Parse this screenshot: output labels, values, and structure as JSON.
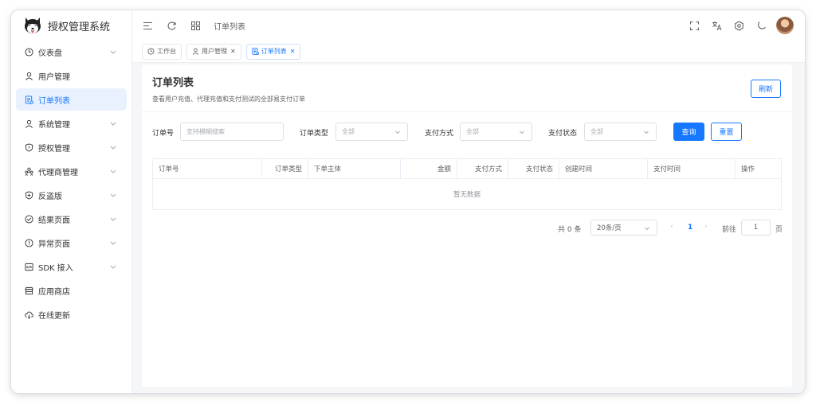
{
  "app": {
    "title": "授权管理系统"
  },
  "sidebar": {
    "items": [
      {
        "label": "仪表盘",
        "icon": "dashboard-icon",
        "expandable": true
      },
      {
        "label": "用户管理",
        "icon": "user-icon",
        "expandable": false
      },
      {
        "label": "订单列表",
        "icon": "order-list-icon",
        "expandable": false,
        "active": true
      },
      {
        "label": "系统管理",
        "icon": "user-settings-icon",
        "expandable": true
      },
      {
        "label": "授权管理",
        "icon": "shield-icon",
        "expandable": true
      },
      {
        "label": "代理商管理",
        "icon": "agents-icon",
        "expandable": true
      },
      {
        "label": "反盗版",
        "icon": "shield-plus-icon",
        "expandable": true
      },
      {
        "label": "结果页面",
        "icon": "check-circle-icon",
        "expandable": true
      },
      {
        "label": "异常页面",
        "icon": "warning-circle-icon",
        "expandable": true
      },
      {
        "label": "SDK 接入",
        "icon": "code-icon",
        "expandable": true
      },
      {
        "label": "应用商店",
        "icon": "store-icon",
        "expandable": false
      },
      {
        "label": "在线更新",
        "icon": "cloud-download-icon",
        "expandable": false
      }
    ]
  },
  "topbar": {
    "breadcrumb": "订单列表",
    "icons": [
      "menu-fold-icon",
      "refresh-icon",
      "grid-icon",
      "fullscreen-icon",
      "translate-icon",
      "settings-icon",
      "moon-icon"
    ]
  },
  "tabs": [
    {
      "label": "工作台",
      "icon": "dashboard-icon",
      "closable": false,
      "active": false
    },
    {
      "label": "用户管理",
      "icon": "user-icon",
      "closable": true,
      "active": false
    },
    {
      "label": "订单列表",
      "icon": "order-list-icon",
      "closable": true,
      "active": true
    }
  ],
  "page": {
    "title": "订单列表",
    "description": "查看用户充值、代理充值和支付测试的全部易支付订单",
    "refresh_label": "刷新"
  },
  "filters": {
    "order_no_label": "订单号",
    "order_no_placeholder": "支持模糊搜索",
    "order_type_label": "订单类型",
    "order_type_value": "全部",
    "pay_method_label": "支付方式",
    "pay_method_value": "全部",
    "pay_status_label": "支付状态",
    "pay_status_value": "全部",
    "search_label": "查询",
    "reset_label": "重置"
  },
  "table": {
    "columns": [
      "订单号",
      "订单类型",
      "下单主体",
      "金额",
      "支付方式",
      "支付状态",
      "创建时间",
      "支付时间",
      "操作"
    ],
    "empty_text": "暂无数据"
  },
  "pagination": {
    "total_text": "共 0 条",
    "page_size": "20条/页",
    "current_page": "1",
    "goto_label": "前往",
    "goto_value": "1",
    "page_suffix": "页"
  },
  "colors": {
    "accent": "#1677ff",
    "active_bg": "#e8f1fd",
    "page_bg": "#f5f6f8"
  }
}
